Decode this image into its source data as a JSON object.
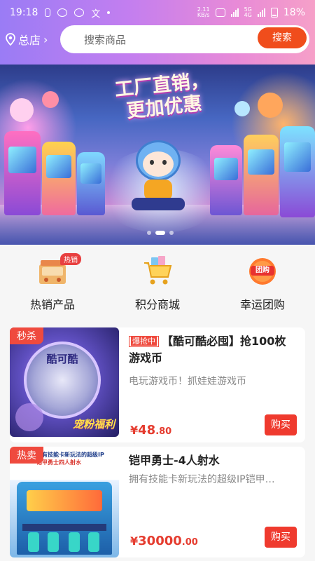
{
  "status_bar": {
    "time": "19:18",
    "speed_value": "2.11",
    "speed_unit": "KB/s",
    "network": "5G",
    "network2": "4G",
    "battery": "18%"
  },
  "header": {
    "store_label": "总店",
    "search_placeholder": "搜索商品",
    "search_button": "搜索"
  },
  "banner": {
    "headline_line1": "工厂直销，",
    "headline_line2": "更加优惠",
    "slides": 3,
    "active_slide": 1
  },
  "quick_entries": [
    {
      "label": "热销产品",
      "badge": "热销",
      "icon": "hot-products-icon"
    },
    {
      "label": "积分商城",
      "badge": "",
      "icon": "points-mall-cart-icon"
    },
    {
      "label": "幸运团购",
      "badge": "",
      "icon": "group-buy-icon",
      "icon_text": "团购"
    }
  ],
  "products": [
    {
      "corner_tag": "秒杀",
      "flash_prefix": "爆抢中",
      "title": "【酷可酷必囤】抢100枚游戏币",
      "desc": "电玩游戏币！抓娃娃游戏币",
      "price_symbol": "¥",
      "price_int": "48",
      "price_dec": ".80",
      "buy_label": "购买",
      "thumb_caption": "宠粉福利",
      "thumb_coin_text": "酷可酷"
    },
    {
      "corner_tag": "热卖",
      "title": "铠甲勇士-4人射水",
      "desc": "拥有技能卡新玩法的超级IP铠甲…",
      "price_symbol": "¥",
      "price_int": "30000",
      "price_dec": ".00",
      "buy_label": "购买",
      "thumb_caption_line1": "拥有技能卡新玩法的超级IP",
      "thumb_caption_line2": "铠甲勇士四人射水"
    }
  ],
  "colors": {
    "accent": "#f04d1c",
    "price": "#e53c2f",
    "header_gradient_start": "#9a7cf5",
    "header_gradient_end": "#f6a0c8"
  }
}
